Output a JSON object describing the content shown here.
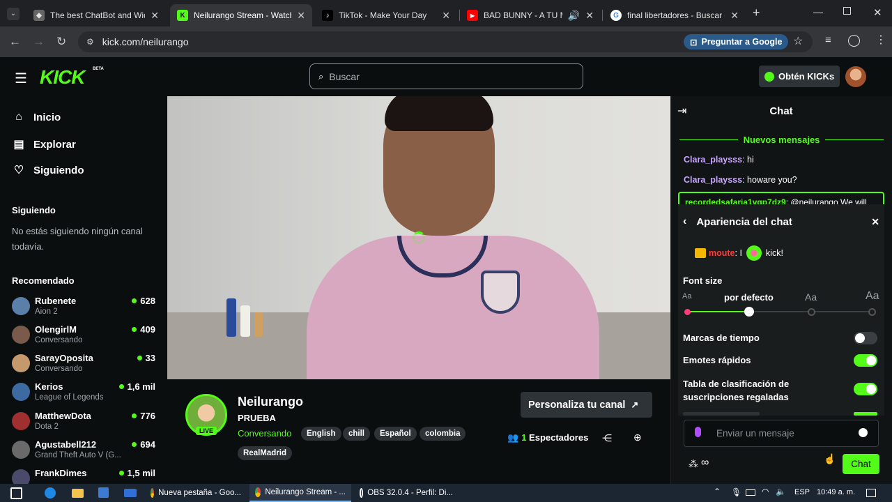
{
  "browser": {
    "tabs": [
      {
        "title": "The best ChatBot and Widge",
        "favicon_color": "#888888"
      },
      {
        "title": "Neilurango Stream - Watch",
        "favicon_color": "#53fc18",
        "active": true
      },
      {
        "title": "TikTok - Make Your Day",
        "favicon_color": "#000000"
      },
      {
        "title": "BAD BUNNY - A TU MER",
        "favicon_color": "#ff0000"
      },
      {
        "title": "final libertadores - Buscar co",
        "favicon_color": "#4285f4"
      }
    ],
    "url": "kick.com/neilurango",
    "ask_google_label": "Preguntar a Google"
  },
  "header": {
    "logo": "KICK",
    "beta": "BETA",
    "search_placeholder": "Buscar",
    "get_kicks_label": "Obtén KICKs"
  },
  "sidebar": {
    "nav": [
      {
        "label": "Inicio",
        "icon": "home-icon"
      },
      {
        "label": "Explorar",
        "icon": "browse-icon"
      },
      {
        "label": "Siguiendo",
        "icon": "heart-icon"
      }
    ],
    "following_title": "Siguiendo",
    "following_empty": "No estás siguiendo ningún canal todavía.",
    "recommended_title": "Recomendado",
    "recommended": [
      {
        "name": "Rubenete",
        "category": "Aion 2",
        "viewers": "628",
        "avatar_color": "#5a7fa8"
      },
      {
        "name": "OlengirlM",
        "category": "Conversando",
        "viewers": "409",
        "avatar_color": "#7a5a4a"
      },
      {
        "name": "SarayOposita",
        "category": "Conversando",
        "viewers": "33",
        "avatar_color": "#c49a6c"
      },
      {
        "name": "Kerios",
        "category": "League of Legends",
        "viewers": "1,6 mil",
        "avatar_color": "#3d6aa0"
      },
      {
        "name": "MatthewDota",
        "category": "Dota 2",
        "viewers": "776",
        "avatar_color": "#a03030"
      },
      {
        "name": "Agustabell212",
        "category": "Grand Theft Auto V (G...",
        "viewers": "694",
        "avatar_color": "#6a6a6a"
      },
      {
        "name": "FrankDimes",
        "category": "",
        "viewers": "1,5 mil",
        "avatar_color": "#4a4a6a"
      }
    ]
  },
  "channel": {
    "live_badge": "LIVE",
    "name": "Neilurango",
    "title": "PRUEBA",
    "category": "Conversando",
    "tags": [
      "English",
      "chill",
      "Español",
      "colombia",
      "RealMadrid"
    ],
    "customize_label": "Personaliza tu canal",
    "viewers_count": "1",
    "viewers_label": "Espectadores"
  },
  "chat": {
    "title": "Chat",
    "new_messages": "Nuevos mensajes",
    "messages": [
      {
        "user": "Clara_playsss",
        "text": "hi"
      },
      {
        "user": "Clara_playsss",
        "text": "howare you?"
      }
    ],
    "highlighted": {
      "user": "recordedsafaria1vgp7dz9",
      "text": "@neilurango We will"
    },
    "appearance": {
      "title": "Apariencia del chat",
      "preview_user": "moute",
      "preview_text_a": ": I",
      "preview_text_b": "kick!",
      "font_size_label": "Font size",
      "font_small": "Aa",
      "font_default_label": "por defecto",
      "font_medium": "Aa",
      "font_large": "Aa",
      "font_size_level": 1,
      "options": [
        {
          "label": "Marcas de tiempo",
          "on": false
        },
        {
          "label": "Emotes rápidos",
          "on": true
        },
        {
          "label": "Tabla de clasificación de suscripciones regaladas",
          "on": true
        }
      ]
    },
    "input_placeholder": "Enviar un mensaje",
    "send_label": "Chat"
  },
  "taskbar": {
    "items": [
      {
        "label": "Nueva pestaña - Goo..."
      },
      {
        "label": "Neilurango Stream - ...",
        "active": true
      },
      {
        "label": "OBS 32.0.4 - Perfil: Di..."
      }
    ],
    "language": "ESP",
    "time": "10:49 a. m."
  }
}
